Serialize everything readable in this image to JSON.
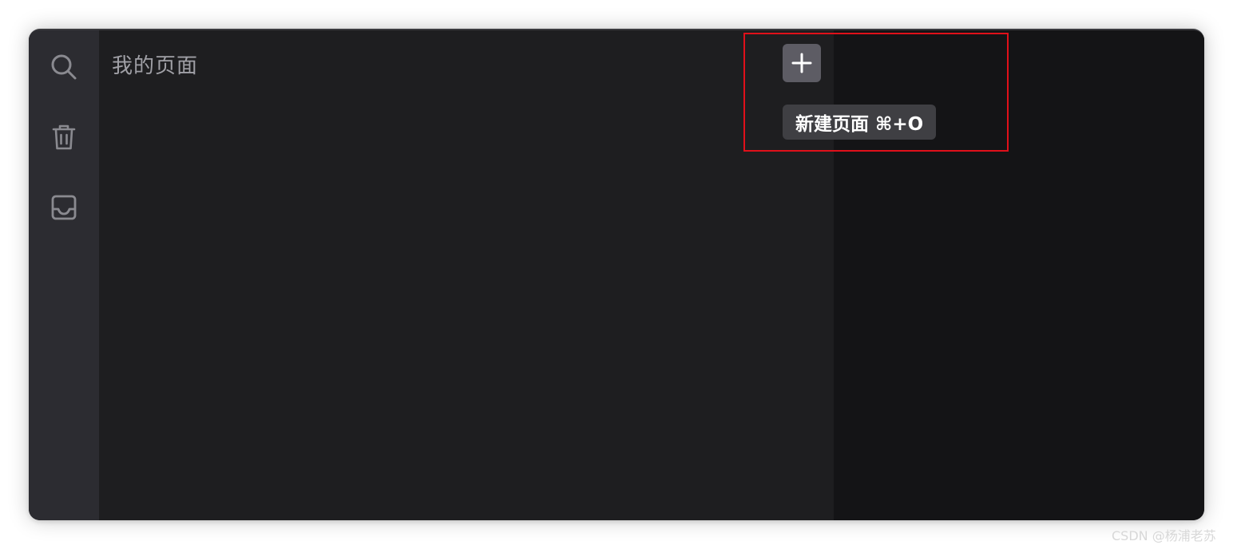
{
  "sidebar": {
    "icons": [
      "search-icon",
      "trash-icon",
      "inbox-icon"
    ]
  },
  "pages_panel": {
    "title": "我的页面"
  },
  "new_page": {
    "button_icon": "plus-icon",
    "tooltip": "新建页面 ⌘+O"
  },
  "annotation": {
    "highlight_color": "#e0101a"
  },
  "watermark": {
    "text": "CSDN @杨浦老苏"
  },
  "colors": {
    "rail_bg": "#2c2c31",
    "pages_bg": "#1e1e20",
    "content_bg": "#141416",
    "button_bg": "#5d5c64",
    "tooltip_bg": "#3f3f43"
  }
}
